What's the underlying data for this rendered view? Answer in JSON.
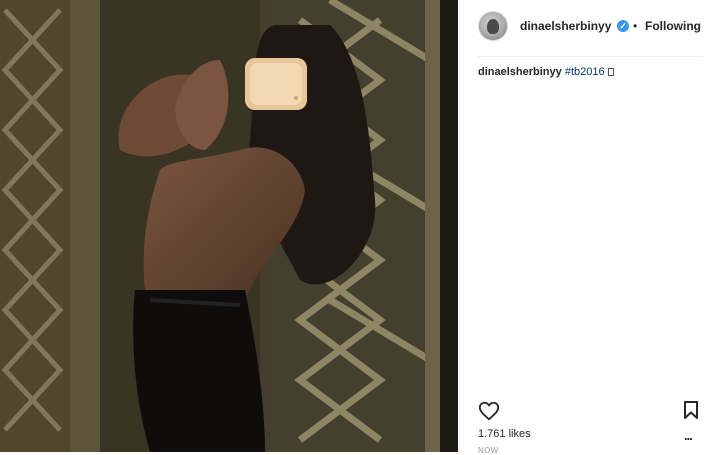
{
  "post": {
    "author": {
      "username": "dinaelsherbinyy",
      "verified_mark": "✓",
      "separator": "•",
      "follow_status": "Following"
    },
    "caption": {
      "username": "dinaelsherbinyy",
      "hashtag": "#tb2016"
    },
    "likes_text": "1.761 likes",
    "more_label": "...",
    "timestamp": "NOW"
  },
  "icons": {
    "avatar": "avatar-image",
    "verified": "verified-badge-icon",
    "like": "heart-icon",
    "save": "bookmark-icon",
    "more": "more-options-icon"
  },
  "colors": {
    "verified_blue": "#3897f0",
    "hashtag": "#003569",
    "text": "#262626",
    "divider": "#efefef"
  }
}
